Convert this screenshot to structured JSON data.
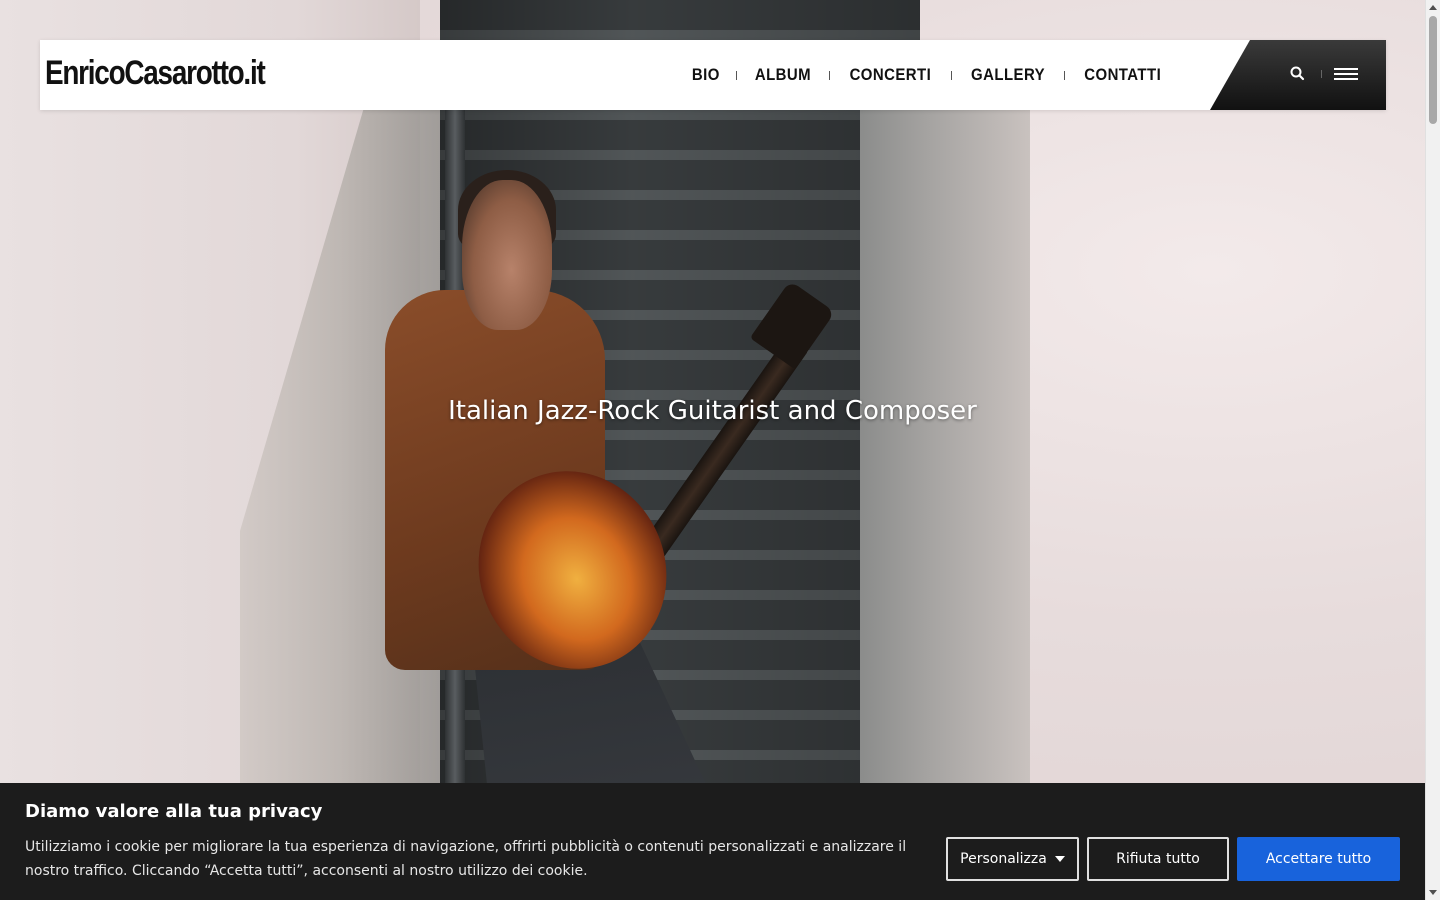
{
  "site": {
    "logo": "EnricoCasarotto.it",
    "tagline": "Italian Jazz-Rock Guitarist and Composer"
  },
  "nav": {
    "items": [
      {
        "label": "BIO"
      },
      {
        "label": "ALBUM"
      },
      {
        "label": "CONCERTI"
      },
      {
        "label": "GALLERY"
      },
      {
        "label": "CONTATTI"
      }
    ],
    "search_icon": "search-icon",
    "menu_icon": "hamburger-menu-icon"
  },
  "cookie_banner": {
    "title": "Diamo valore alla tua privacy",
    "text": "Utilizziamo i cookie per migliorare la tua esperienza di navigazione, offrirti pubblicità o contenuti personalizzati e analizzare il nostro traffico. Cliccando “Accetta tutti”, acconsenti al nostro utilizzo dei cookie.",
    "customize_label": "Personalizza",
    "reject_label": "Rifiuta tutto",
    "accept_label": "Accettare tutto",
    "accept_color": "#1863dc",
    "background_color": "#1c1c1c"
  }
}
